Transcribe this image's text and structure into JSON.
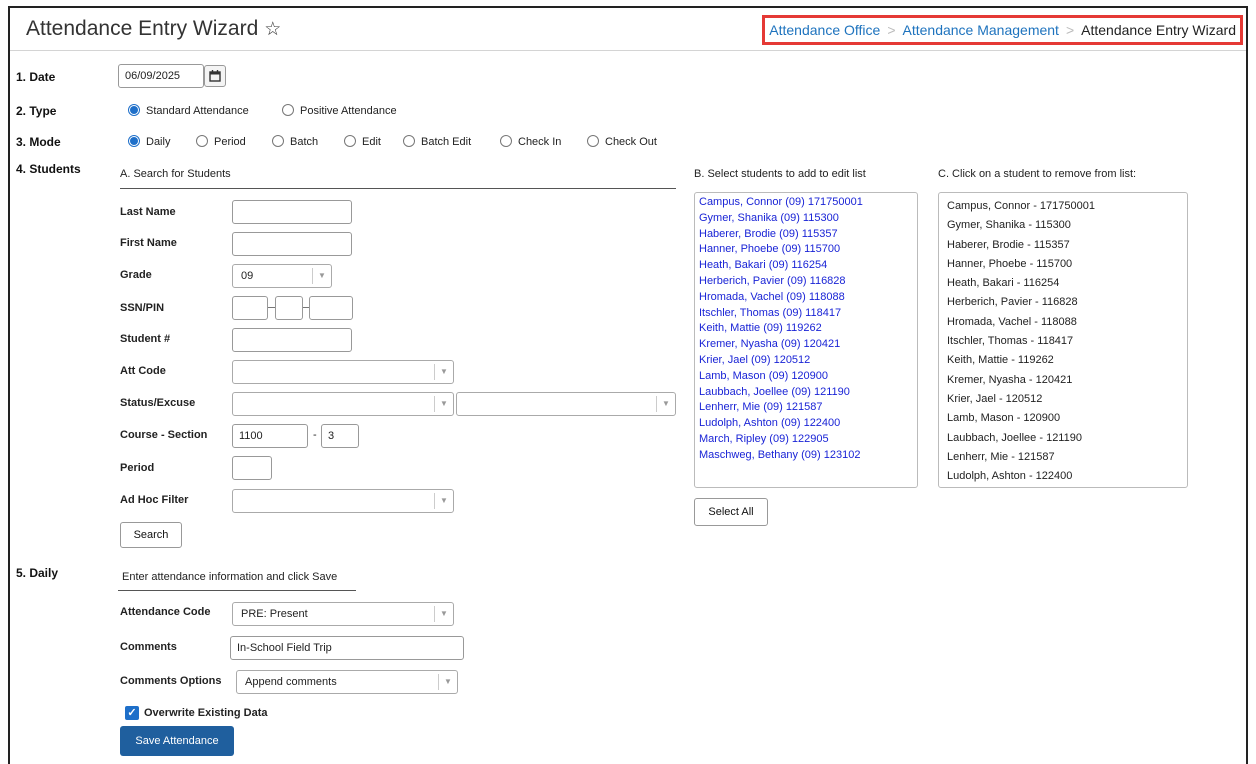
{
  "header": {
    "title": "Attendance Entry Wizard",
    "star_icon": "☆",
    "breadcrumb": [
      "Attendance Office",
      "Attendance Management",
      "Attendance Entry Wizard"
    ],
    "breadcrumb_sep": ">"
  },
  "sections": {
    "date": {
      "label": "1. Date",
      "value": "06/09/2025"
    },
    "type": {
      "label": "2. Type",
      "options": [
        "Standard Attendance",
        "Positive Attendance"
      ],
      "selected": "Standard Attendance"
    },
    "mode": {
      "label": "3. Mode",
      "options": [
        "Daily",
        "Period",
        "Batch",
        "Edit",
        "Batch Edit",
        "Check In",
        "Check Out"
      ],
      "selected": "Daily"
    },
    "students": {
      "label": "4. Students"
    },
    "daily": {
      "label": "5. Daily"
    }
  },
  "search": {
    "heading": "A. Search for Students",
    "last_name_label": "Last Name",
    "first_name_label": "First Name",
    "grade_label": "Grade",
    "grade_value": "09",
    "ssn_label": "SSN/PIN",
    "student_num_label": "Student #",
    "att_code_label": "Att Code",
    "status_label": "Status/Excuse",
    "course_label": "Course - Section",
    "course_value": "1100",
    "section_value": "3",
    "course_dash": "-",
    "period_label": "Period",
    "adhoc_label": "Ad Hoc Filter",
    "search_button": "Search"
  },
  "select_list": {
    "heading": "B. Select students to add to edit list",
    "items": [
      "Campus, Connor (09) 171750001",
      "Gymer, Shanika (09) 115300",
      "Haberer, Brodie (09) 115357",
      "Hanner, Phoebe (09) 115700",
      "Heath, Bakari (09) 116254",
      "Herberich, Pavier (09) 116828",
      "Hromada, Vachel (09) 118088",
      "Itschler, Thomas (09) 118417",
      "Keith, Mattie (09) 119262",
      "Kremer, Nyasha (09) 120421",
      "Krier, Jael (09) 120512",
      "Lamb, Mason (09) 120900",
      "Laubbach, Joellee (09) 121190",
      "Lenherr, Mie (09) 121587",
      "Ludolph, Ashton (09) 122400",
      "March, Ripley (09) 122905",
      "Maschweg, Bethany (09) 123102"
    ],
    "select_all_button": "Select All"
  },
  "remove_list": {
    "heading": "C. Click on a student to remove from list:",
    "items": [
      "Campus, Connor - 171750001",
      "Gymer, Shanika - 115300",
      "Haberer, Brodie - 115357",
      "Hanner, Phoebe - 115700",
      "Heath, Bakari - 116254",
      "Herberich, Pavier - 116828",
      "Hromada, Vachel - 118088",
      "Itschler, Thomas - 118417",
      "Keith, Mattie - 119262",
      "Kremer, Nyasha - 120421",
      "Krier, Jael - 120512",
      "Lamb, Mason - 120900",
      "Laubbach, Joellee - 121190",
      "Lenherr, Mie - 121587",
      "Ludolph, Ashton - 122400"
    ]
  },
  "daily_form": {
    "heading": "Enter attendance information and click Save",
    "attendance_code_label": "Attendance Code",
    "attendance_code_value": "PRE: Present",
    "comments_label": "Comments",
    "comments_value": "In-School Field Trip",
    "comments_options_label": "Comments Options",
    "comments_options_value": "Append comments",
    "overwrite_label": "Overwrite Existing Data",
    "overwrite_checked": true,
    "save_button": "Save Attendance"
  },
  "colors": {
    "accent": "#1e6fc9",
    "link": "#1e73be",
    "list_link": "#1a24d6",
    "primary_button": "#1f5f9e",
    "highlight_border": "#e53935"
  }
}
